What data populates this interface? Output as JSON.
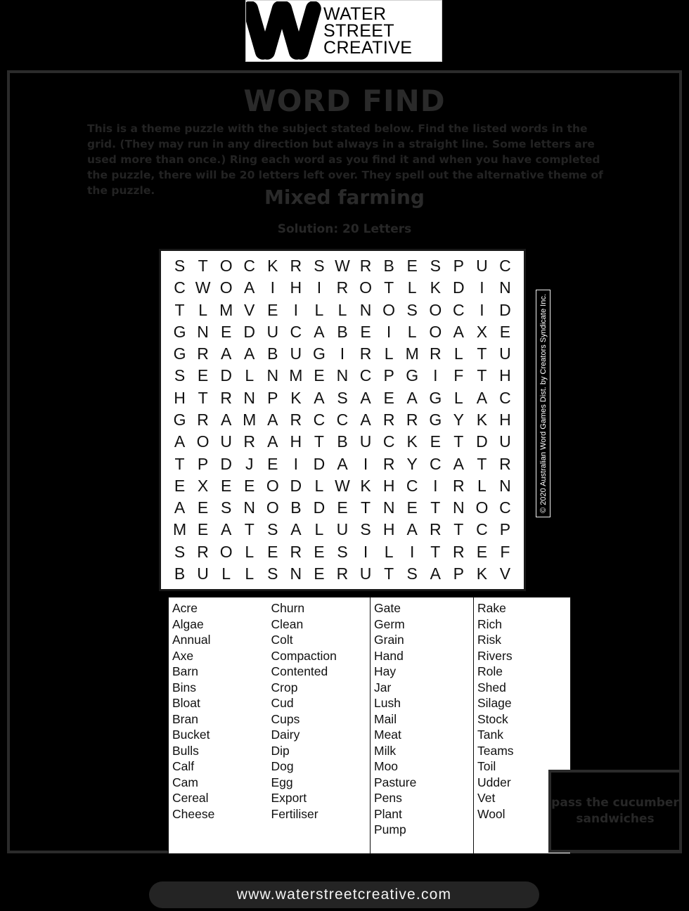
{
  "logo": {
    "mark_icon": "w-monogram-icon",
    "lines": [
      "WATER",
      "STREET",
      "CREATIVE"
    ]
  },
  "puzzle": {
    "title": "WORD FIND",
    "instructions": "This is a theme puzzle with the subject stated below. Find the listed words in the grid. (They may run in any direction but always in a straight line. Some letters are used more than once.) Ring each word as you find it and when you have completed the puzzle, there will be 20 letters left over. They spell out the alternative theme of the puzzle.",
    "theme": "Mixed farming",
    "solution_note": "Solution: 20 Letters",
    "copyright": "© 2020 Australian Word Games Dist. by Creators Syndicate Inc.",
    "grid": [
      [
        "S",
        "T",
        "O",
        "C",
        "K",
        "R",
        "S",
        "W",
        "R",
        "B",
        "E",
        "S",
        "P",
        "U",
        "C"
      ],
      [
        "C",
        "W",
        "O",
        "A",
        "I",
        "H",
        "I",
        "R",
        "O",
        "T",
        "L",
        "K",
        "D",
        "I",
        "N"
      ],
      [
        "T",
        "L",
        "M",
        "V",
        "E",
        "I",
        "L",
        "L",
        "N",
        "O",
        "S",
        "O",
        "C",
        "I",
        "D"
      ],
      [
        "G",
        "N",
        "E",
        "D",
        "U",
        "C",
        "A",
        "B",
        "E",
        "I",
        "L",
        "O",
        "A",
        "X",
        "E"
      ],
      [
        "G",
        "R",
        "A",
        "A",
        "B",
        "U",
        "G",
        "I",
        "R",
        "L",
        "M",
        "R",
        "L",
        "T",
        "U"
      ],
      [
        "S",
        "E",
        "D",
        "L",
        "N",
        "M",
        "E",
        "N",
        "C",
        "P",
        "G",
        "I",
        "F",
        "T",
        "H"
      ],
      [
        "H",
        "T",
        "R",
        "N",
        "P",
        "K",
        "A",
        "S",
        "A",
        "E",
        "A",
        "G",
        "L",
        "A",
        "C"
      ],
      [
        "G",
        "R",
        "A",
        "M",
        "A",
        "R",
        "C",
        "C",
        "A",
        "R",
        "R",
        "G",
        "Y",
        "K",
        "H"
      ],
      [
        "A",
        "O",
        "U",
        "R",
        "A",
        "H",
        "T",
        "B",
        "U",
        "C",
        "K",
        "E",
        "T",
        "D",
        "U"
      ],
      [
        "T",
        "P",
        "D",
        "J",
        "E",
        "I",
        "D",
        "A",
        "I",
        "R",
        "Y",
        "C",
        "A",
        "T",
        "R"
      ],
      [
        "E",
        "X",
        "E",
        "E",
        "O",
        "D",
        "L",
        "W",
        "K",
        "H",
        "C",
        "I",
        "R",
        "L",
        "N"
      ],
      [
        "A",
        "E",
        "S",
        "N",
        "O",
        "B",
        "D",
        "E",
        "T",
        "N",
        "E",
        "T",
        "N",
        "O",
        "C"
      ],
      [
        "M",
        "E",
        "A",
        "T",
        "S",
        "A",
        "L",
        "U",
        "S",
        "H",
        "A",
        "R",
        "T",
        "C",
        "P"
      ],
      [
        "S",
        "R",
        "O",
        "L",
        "E",
        "R",
        "E",
        "S",
        "I",
        "L",
        "I",
        "T",
        "R",
        "E",
        "F"
      ],
      [
        "B",
        "U",
        "L",
        "L",
        "S",
        "N",
        "E",
        "R",
        "U",
        "T",
        "S",
        "A",
        "P",
        "K",
        "V"
      ]
    ],
    "word_columns": [
      [
        "Acre",
        "Algae",
        "Annual",
        "Axe",
        "Barn",
        "Bins",
        "Bloat",
        "Bran",
        "Bucket",
        "Bulls",
        "Calf",
        "Cam",
        "Cereal",
        "Cheese"
      ],
      [
        "Churn",
        "Clean",
        "Colt",
        "Compaction",
        "Contented",
        "Crop",
        "Cud",
        "Cups",
        "Dairy",
        "Dip",
        "Dog",
        "Egg",
        "Export",
        "Fertiliser"
      ],
      [
        "Gate",
        "Germ",
        "Grain",
        "Hand",
        "Hay",
        "Jar",
        "Lush",
        "Mail",
        "Meat",
        "Milk",
        "Moo",
        "Pasture",
        "Pens",
        "Plant",
        "Pump"
      ],
      [
        "Rake",
        "Rich",
        "Risk",
        "Rivers",
        "Role",
        "Shed",
        "Silage",
        "Stock",
        "Tank",
        "Teams",
        "Toil",
        "Udder",
        "Vet",
        "Wool"
      ]
    ]
  },
  "caption": "pass the cucumber sandwiches",
  "footer": {
    "url": "www.waterstreetcreative.com"
  },
  "colors": {
    "page_background": "#000000",
    "frame_border": "#2b2b2b",
    "muted_text": "#2a2a2a",
    "paper": "#ffffff",
    "footer_pill": "#242424"
  }
}
